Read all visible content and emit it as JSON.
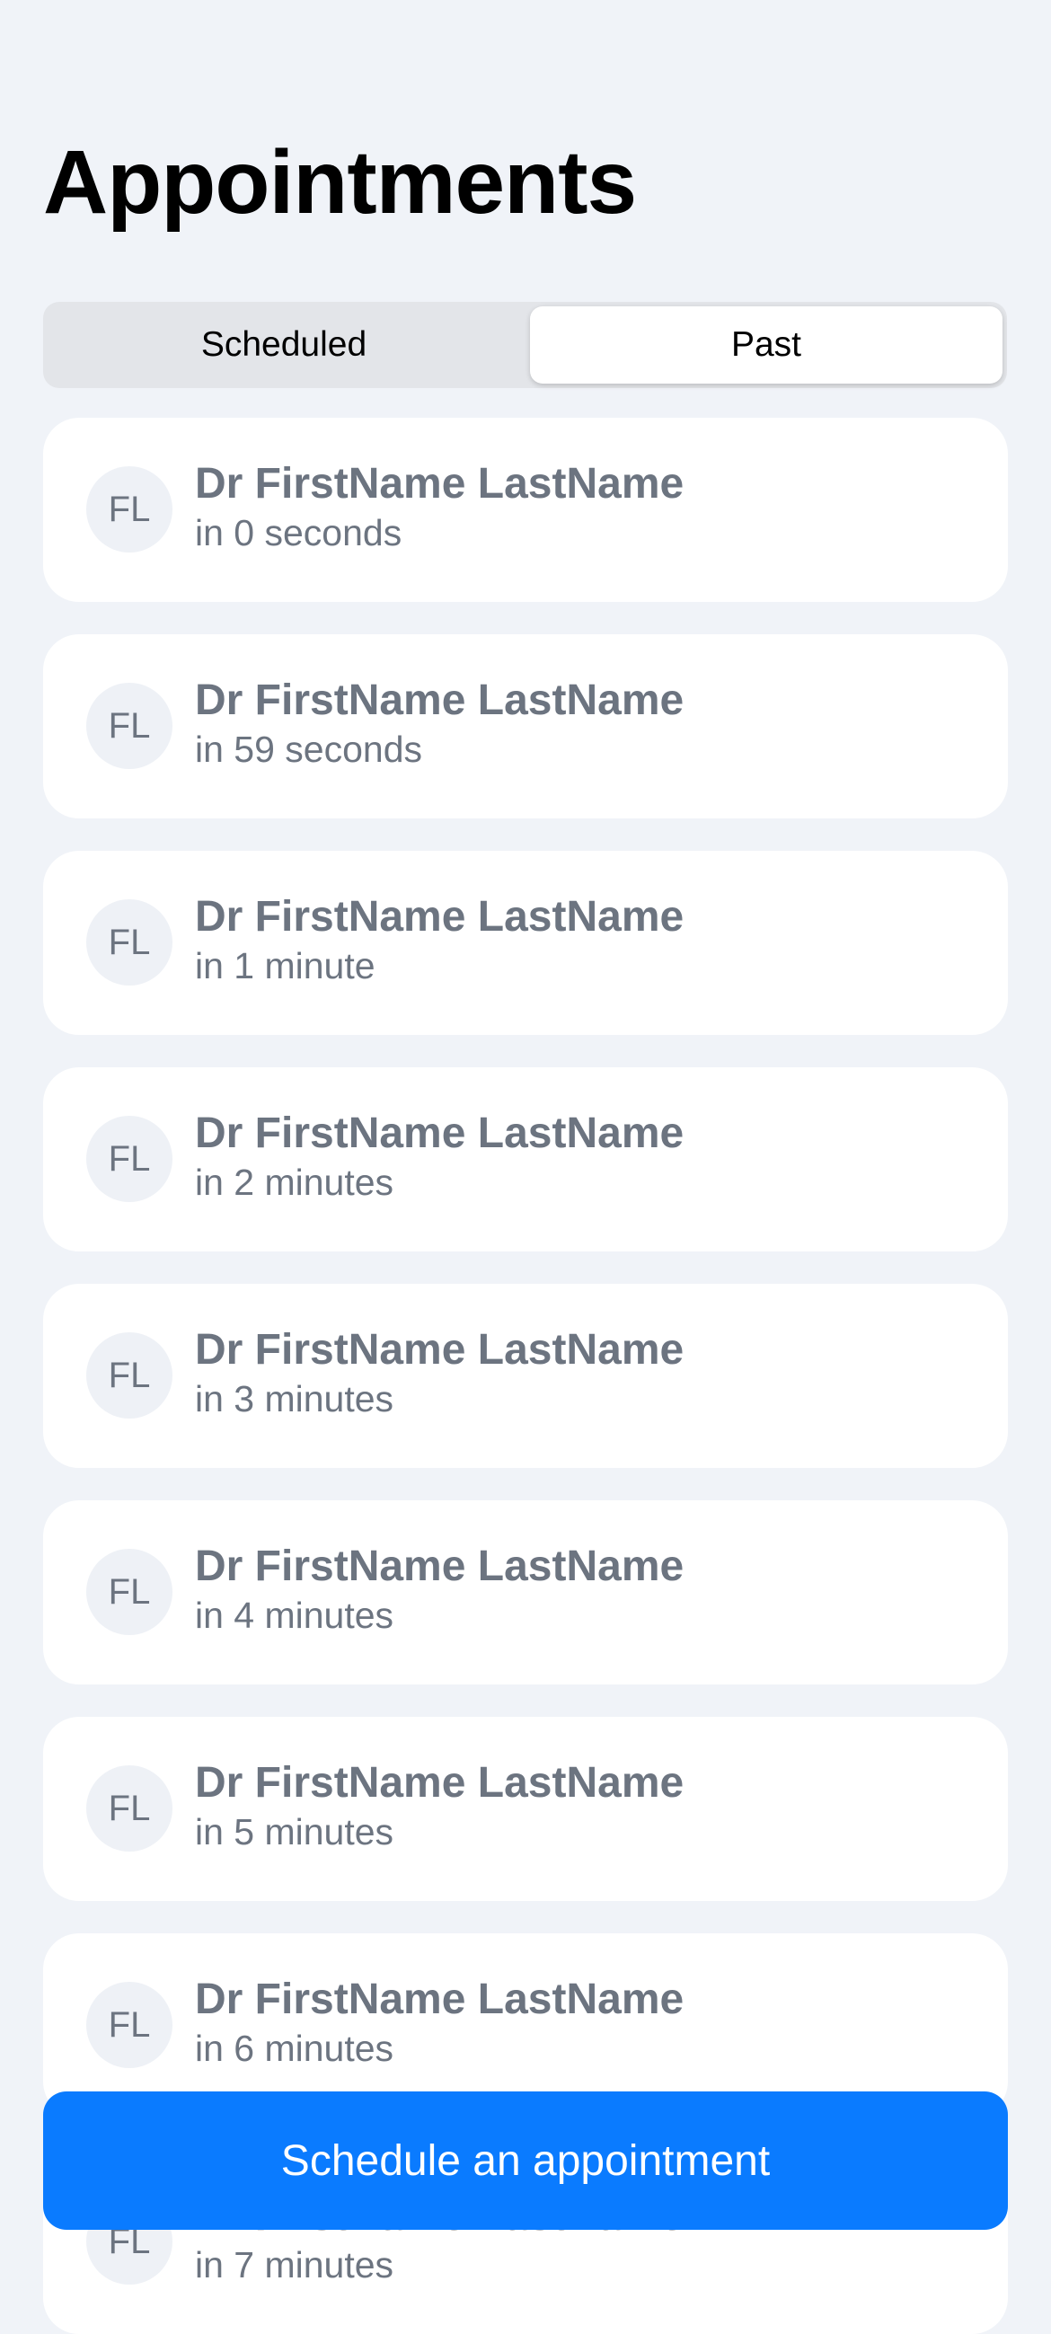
{
  "header": {
    "title": "Appointments"
  },
  "segments": [
    {
      "label": "Scheduled",
      "selected": false
    },
    {
      "label": "Past",
      "selected": true
    }
  ],
  "appointments": [
    {
      "initials": "FL",
      "name": "Dr FirstName LastName",
      "time": "in 0 seconds"
    },
    {
      "initials": "FL",
      "name": "Dr FirstName LastName",
      "time": "in 59 seconds"
    },
    {
      "initials": "FL",
      "name": "Dr FirstName LastName",
      "time": "in 1 minute"
    },
    {
      "initials": "FL",
      "name": "Dr FirstName LastName",
      "time": "in 2 minutes"
    },
    {
      "initials": "FL",
      "name": "Dr FirstName LastName",
      "time": "in 3 minutes"
    },
    {
      "initials": "FL",
      "name": "Dr FirstName LastName",
      "time": "in 4 minutes"
    },
    {
      "initials": "FL",
      "name": "Dr FirstName LastName",
      "time": "in 5 minutes"
    },
    {
      "initials": "FL",
      "name": "Dr FirstName LastName",
      "time": "in 6 minutes"
    },
    {
      "initials": "FL",
      "name": "Dr FirstName LastName",
      "time": "in 7 minutes"
    }
  ],
  "action": {
    "label": "Schedule an appointment"
  },
  "colors": {
    "background": "#f0f3f8",
    "accent": "#0a7bff",
    "muted_text": "#6c7480",
    "card": "#ffffff"
  }
}
